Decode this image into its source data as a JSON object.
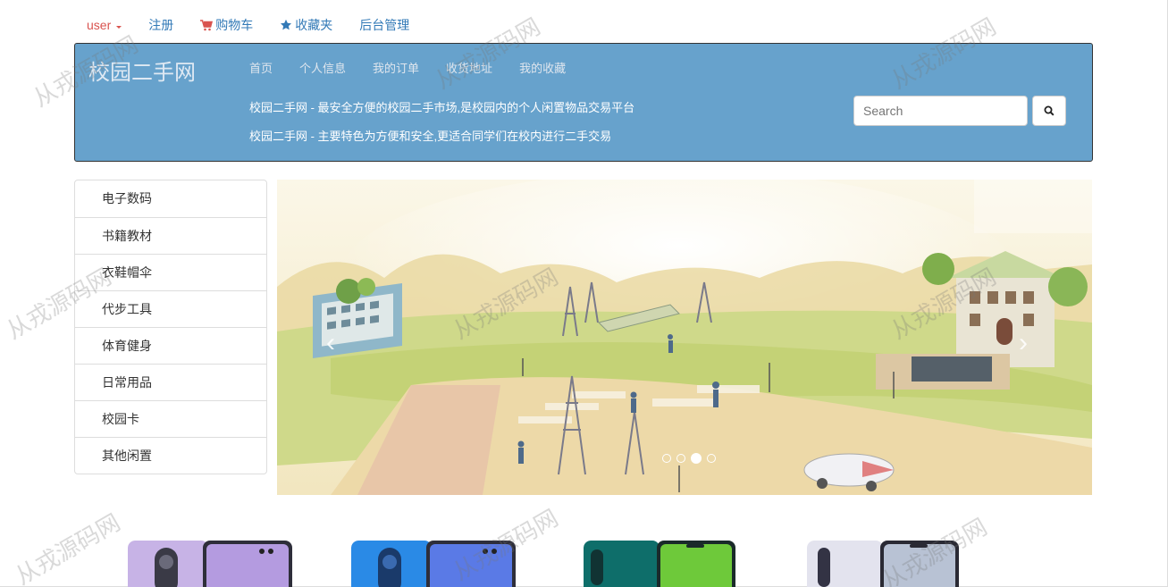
{
  "topnav": {
    "user_label": "user",
    "register_label": "注册",
    "cart_label": "购物车",
    "favorites_label": "收藏夹",
    "admin_label": "后台管理"
  },
  "header": {
    "brand": "校园二手网",
    "nav": [
      "首页",
      "个人信息",
      "我的订单",
      "收货地址",
      "我的收藏"
    ],
    "slogan1": "校园二手网 - 最安全方便的校园二手市场,是校园内的个人闲置物品交易平台",
    "slogan2": "校园二手网 - 主要特色为方便和安全,更适合同学们在校内进行二手交易",
    "search_placeholder": "Search"
  },
  "sidebar": {
    "items": [
      "电子数码",
      "书籍教材",
      "衣鞋帽伞",
      "代步工具",
      "体育健身",
      "日常用品",
      "校园卡",
      "其他闲置"
    ]
  },
  "carousel": {
    "slide_count": 4,
    "active_index": 2
  },
  "watermark": "从戎源码网",
  "colors": {
    "header_bg": "#67a2cc",
    "link": "#337ab7",
    "user": "#d9534f"
  }
}
